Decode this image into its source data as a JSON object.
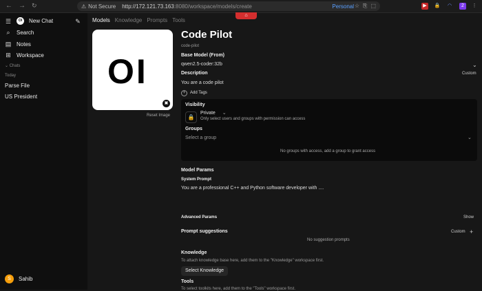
{
  "browser": {
    "security_label": "Not Secure",
    "url_host": "http://172.121.73.163",
    "url_rest": ":8080/workspace/models/create",
    "profile": "Personal"
  },
  "sidebar": {
    "new_chat": "New Chat",
    "search": "Search",
    "notes": "Notes",
    "workspace": "Workspace",
    "chats_label": "Chats",
    "today_label": "Today",
    "chats": [
      "Parse File",
      "US President"
    ],
    "user": {
      "initial": "S",
      "name": "Sahib"
    }
  },
  "tabs": {
    "items": [
      "Models",
      "Knowledge",
      "Prompts",
      "Tools"
    ],
    "active": "Models"
  },
  "model": {
    "logo_text": "OI",
    "reset_image": "Reset Image",
    "name": "Code Pilot",
    "slug": "code-pilot",
    "base_model_label": "Base Model (From)",
    "base_model_value": "qwen2.5-coder:32b",
    "description_label": "Description",
    "description_mode": "Custom",
    "description_value": "You are a code pilot",
    "add_tags": "Add Tags"
  },
  "visibility": {
    "label": "Visibility",
    "value": "Private",
    "hint": "Only select users and groups with permission can access",
    "groups_label": "Groups",
    "groups_placeholder": "Select a group",
    "empty": "No groups with access, add a group to grant access"
  },
  "params": {
    "model_params_label": "Model Params",
    "system_prompt_label": "System Prompt",
    "system_prompt_value": "You are a professional C++ and Python software developer with ....",
    "advanced_label": "Advanced Params",
    "advanced_action": "Show"
  },
  "suggestions": {
    "label": "Prompt suggestions",
    "mode": "Custom",
    "empty": "No suggestion prompts"
  },
  "knowledge": {
    "label": "Knowledge",
    "hint": "To attach knowledge base here, add them to the \"Knowledge\" workspace first.",
    "button": "Select Knowledge"
  },
  "tools": {
    "label": "Tools",
    "hint": "To select toolkits here, add them to the \"Tools\" workspace first."
  }
}
